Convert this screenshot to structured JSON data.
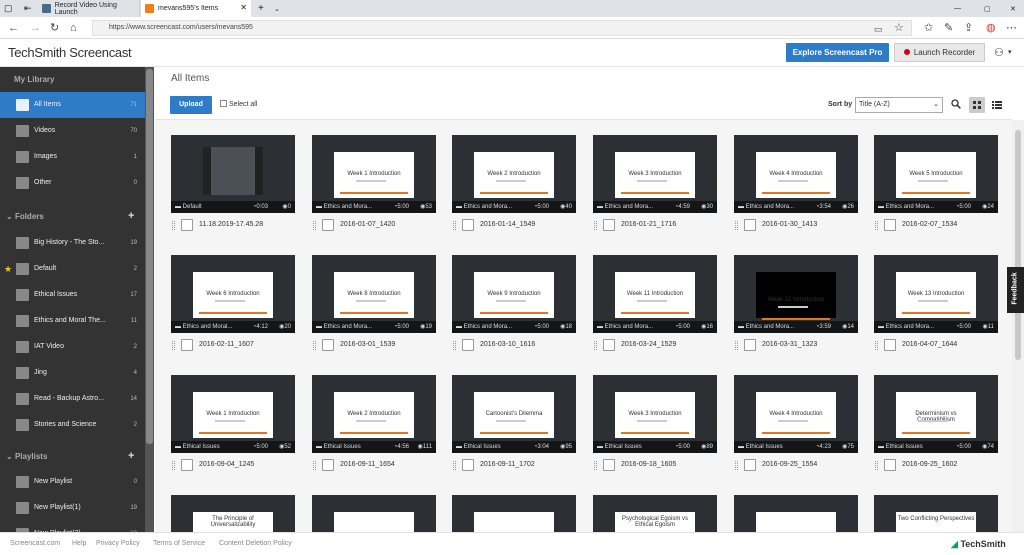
{
  "browser": {
    "tabs": [
      {
        "label": "Record Video Using Launch"
      },
      {
        "label": "mevans595's Items"
      }
    ],
    "url": "https://www.screencast.com/users/mevans595"
  },
  "app": {
    "logo": "TechSmith Screencast",
    "explore_label": "Explore Screencast Pro",
    "launch_label": "Launch Recorder"
  },
  "sidebar": {
    "my_library": "My Library",
    "library_items": [
      {
        "label": "All Items",
        "count": "71"
      },
      {
        "label": "Videos",
        "count": "70"
      },
      {
        "label": "Images",
        "count": "1"
      },
      {
        "label": "Other",
        "count": "0"
      }
    ],
    "folders_label": "Folders",
    "folders": [
      {
        "label": "Big History - The Sto...",
        "count": "19"
      },
      {
        "label": "Default",
        "count": "2"
      },
      {
        "label": "Ethical Issues",
        "count": "17"
      },
      {
        "label": "Ethics and Moral The...",
        "count": "11"
      },
      {
        "label": "IAT Video",
        "count": "2"
      },
      {
        "label": "Jing",
        "count": "4"
      },
      {
        "label": "Read - Backup Astro...",
        "count": "14"
      },
      {
        "label": "Stories and Science",
        "count": "2"
      }
    ],
    "playlists_label": "Playlists",
    "playlists": [
      {
        "label": "New Playlist",
        "count": "0"
      },
      {
        "label": "New Playlist(1)",
        "count": "19"
      },
      {
        "label": "New Playlist(2)",
        "count": "10"
      }
    ]
  },
  "main": {
    "title": "All Items",
    "upload_label": "Upload",
    "select_all_label": "Select all",
    "sort_label": "Sort by",
    "sort_value": "Title (A-Z)"
  },
  "items": [
    {
      "name": "11.18.2019-17.45.28",
      "folder": "Default",
      "duration": "0:03",
      "views": "0",
      "slide": ""
    },
    {
      "name": "2016-01-07_1420",
      "folder": "Ethics and Mora...",
      "duration": "5:00",
      "views": "53",
      "slide": "Week 1 Introduction"
    },
    {
      "name": "2016-01-14_1549",
      "folder": "Ethics and Mora...",
      "duration": "5:00",
      "views": "40",
      "slide": "Week 2 Introduction"
    },
    {
      "name": "2016-01-21_1716",
      "folder": "Ethics and Mora...",
      "duration": "4:59",
      "views": "30",
      "slide": "Week 3 Introduction"
    },
    {
      "name": "2016-01-30_1413",
      "folder": "Ethics and Mora...",
      "duration": "3:54",
      "views": "26",
      "slide": "Week 4 Introduction"
    },
    {
      "name": "2016-02-07_1534",
      "folder": "Ethics and Mora...",
      "duration": "5:00",
      "views": "24",
      "slide": "Week 5 Introduction"
    },
    {
      "name": "2016-02-11_1607",
      "folder": "Ethics and Moral...",
      "duration": "4:12",
      "views": "20",
      "slide": "Week 6 Introduction"
    },
    {
      "name": "2016-03-01_1539",
      "folder": "Ethics and Mora...",
      "duration": "5:00",
      "views": "19",
      "slide": "Week 8 Introduction"
    },
    {
      "name": "2016-03-10_1616",
      "folder": "Ethics and Mora...",
      "duration": "5:00",
      "views": "18",
      "slide": "Week 9 Introduction"
    },
    {
      "name": "2016-03-24_1529",
      "folder": "Ethics and Mora...",
      "duration": "5:00",
      "views": "16",
      "slide": "Week 11 Introduction"
    },
    {
      "name": "2016-03-31_1323",
      "folder": "Ethics and Mora...",
      "duration": "3:59",
      "views": "14",
      "slide": "Week 12 Introduction"
    },
    {
      "name": "2016-04-07_1644",
      "folder": "Ethics and Mora...",
      "duration": "5:00",
      "views": "11",
      "slide": "Week 13 Introduction"
    },
    {
      "name": "2016-09-04_1245",
      "folder": "Ethical Issues",
      "duration": "5:00",
      "views": "52",
      "slide": "Week 1 Introduction"
    },
    {
      "name": "2016-09-11_1654",
      "folder": "Ethical Issues",
      "duration": "4:56",
      "views": "111",
      "slide": "Week 2 Introduction"
    },
    {
      "name": "2016-09-11_1702",
      "folder": "Ethical Issues",
      "duration": "3:04",
      "views": "95",
      "slide": "Cartoonist's Dilemma"
    },
    {
      "name": "2016-09-18_1605",
      "folder": "Ethical Issues",
      "duration": "5:00",
      "views": "89",
      "slide": "Week 3 Introduction"
    },
    {
      "name": "2016-09-25_1554",
      "folder": "Ethical Issues",
      "duration": "4:23",
      "views": "75",
      "slide": "Week 4 Introduction"
    },
    {
      "name": "2016-09-25_1602",
      "folder": "Ethical Issues",
      "duration": "5:00",
      "views": "74",
      "slide": "Determinism vs Compatibilism"
    },
    {
      "name": "",
      "folder": "",
      "duration": "",
      "views": "",
      "slide": "The Principle of Universalizability"
    },
    {
      "name": "",
      "folder": "",
      "duration": "",
      "views": "",
      "slide": ""
    },
    {
      "name": "",
      "folder": "",
      "duration": "",
      "views": "",
      "slide": ""
    },
    {
      "name": "",
      "folder": "",
      "duration": "",
      "views": "",
      "slide": "Psychological Egoism vs Ethical Egoism"
    },
    {
      "name": "",
      "folder": "",
      "duration": "",
      "views": "",
      "slide": ""
    },
    {
      "name": "",
      "folder": "",
      "duration": "",
      "views": "",
      "slide": "Two Conflicting Perspectives"
    }
  ],
  "feedback_label": "Feedback",
  "footer": {
    "links": [
      "Screencast.com",
      "Help",
      "Privacy Policy",
      "Terms of Service",
      "Content Deletion Policy"
    ],
    "brand": "TechSmith"
  },
  "colors": {
    "accent": "#2e7cc7",
    "sidebar": "#333333",
    "record": "#d0021b"
  }
}
